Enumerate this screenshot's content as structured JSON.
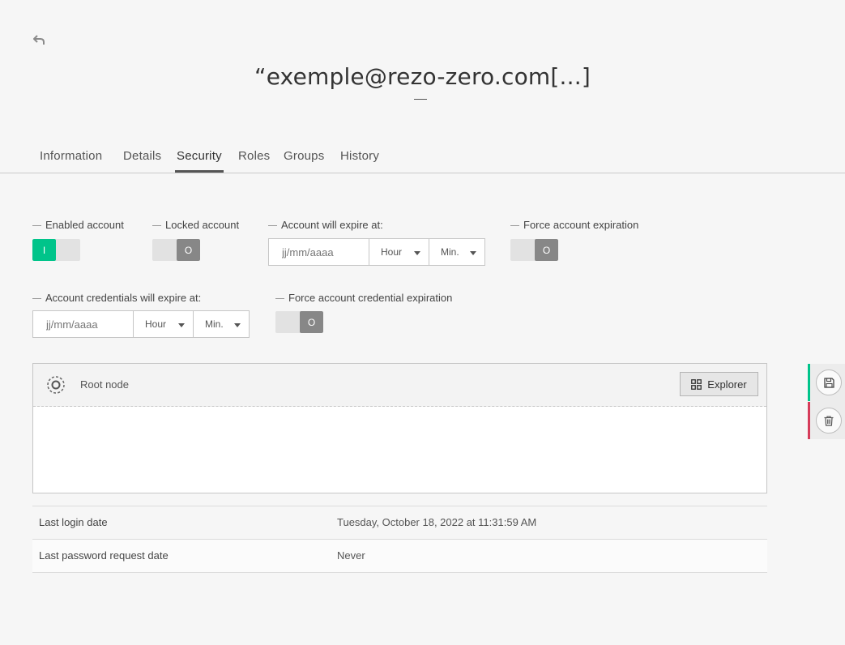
{
  "header": {
    "title": "“exemple@rezo-zero.com[...]"
  },
  "tabs": [
    {
      "label": "Information"
    },
    {
      "label": "Details"
    },
    {
      "label": "Security"
    },
    {
      "label": "Roles"
    },
    {
      "label": "Groups"
    },
    {
      "label": "History"
    }
  ],
  "active_tab": "Security",
  "form": {
    "enabled_account": {
      "label": "Enabled account",
      "value": "I",
      "state": "on"
    },
    "locked_account": {
      "label": "Locked account",
      "value": "O",
      "state": "off"
    },
    "account_expire": {
      "label": "Account will expire at:",
      "date_placeholder": "jj/mm/aaaa",
      "hour_label": "Hour",
      "min_label": "Min."
    },
    "force_account_expiration": {
      "label": "Force account expiration",
      "value": "O",
      "state": "off"
    },
    "credentials_expire": {
      "label": "Account credentials will expire at:",
      "date_placeholder": "jj/mm/aaaa",
      "hour_label": "Hour",
      "min_label": "Min."
    },
    "force_credential_expiration": {
      "label": "Force account credential expiration",
      "value": "O",
      "state": "off"
    }
  },
  "node_picker": {
    "label": "Root node",
    "explorer_label": "Explorer"
  },
  "info": [
    {
      "label": "Last login date",
      "value": "Tuesday, October 18, 2022 at 11:31:59 AM"
    },
    {
      "label": "Last password request date",
      "value": "Never"
    }
  ],
  "colors": {
    "accent_green": "#00c48a",
    "danger_red": "#d63c5a",
    "toggle_off": "#878787"
  },
  "icons": {
    "back": "reply-arrow-icon",
    "node": "target-node-icon",
    "explorer": "grid-icon",
    "save": "floppy-disk-icon",
    "delete": "trash-icon"
  }
}
